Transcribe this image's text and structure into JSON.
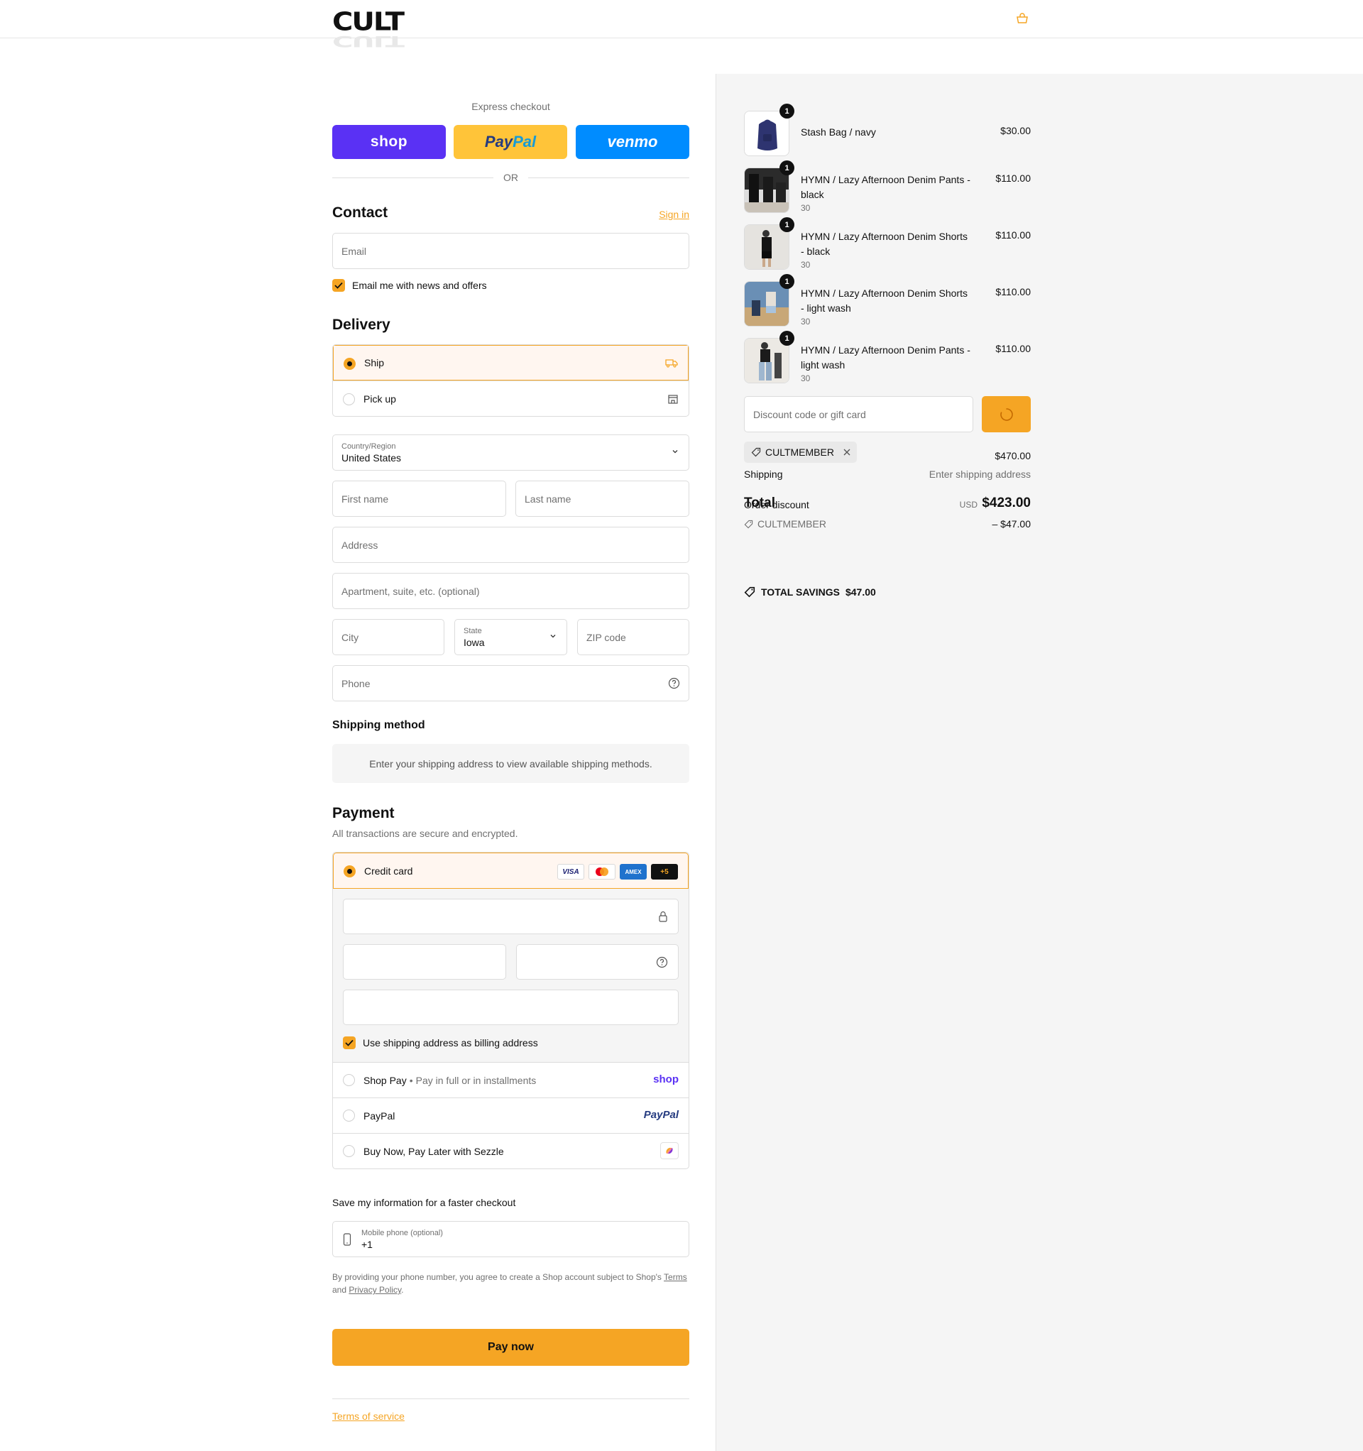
{
  "header": {
    "logo_text": "CULT",
    "cart_icon": "bag-icon"
  },
  "express": {
    "label": "Express checkout",
    "shop_label": "shop",
    "paypal_label_a": "Pay",
    "paypal_label_b": "Pal",
    "venmo_label": "venmo",
    "or_label": "OR"
  },
  "contact": {
    "title": "Contact",
    "signin_label": "Sign in",
    "email_placeholder": "Email",
    "news_label": "Email me with news and offers",
    "news_checked": true
  },
  "delivery": {
    "title": "Delivery",
    "options": [
      {
        "label": "Ship",
        "selected": true,
        "icon": "truck-icon"
      },
      {
        "label": "Pick up",
        "selected": false,
        "icon": "store-icon"
      }
    ],
    "country_label": "Country/Region",
    "country_value": "United States",
    "first_name_placeholder": "First name",
    "last_name_placeholder": "Last name",
    "address_placeholder": "Address",
    "apartment_placeholder": "Apartment, suite, etc. (optional)",
    "city_placeholder": "City",
    "state_label": "State",
    "state_value": "Iowa",
    "zip_placeholder": "ZIP code",
    "phone_placeholder": "Phone"
  },
  "shipping_method": {
    "title": "Shipping method",
    "note": "Enter your shipping address to view available shipping methods."
  },
  "payment": {
    "title": "Payment",
    "subtitle": "All transactions are secure and encrypted.",
    "credit_card_label": "Credit card",
    "card_brands": [
      "VISA",
      "MC",
      "AMEX",
      "+5"
    ],
    "billing_label": "Use shipping address as billing address",
    "billing_checked": true,
    "options": [
      {
        "label": "Shop Pay",
        "sub": "Pay in full or in installments",
        "brand": "shop"
      },
      {
        "label": "PayPal",
        "sub": "",
        "brand": "PayPal"
      },
      {
        "label": "Buy Now, Pay Later with Sezzle",
        "sub": "",
        "brand": "sezzle-icon"
      }
    ]
  },
  "save_info": {
    "title": "Save my information for a faster checkout",
    "mobile_label": "Mobile phone (optional)",
    "mobile_value": "+1",
    "legal_a": "By providing your phone number, you agree to create a Shop account subject to Shop's",
    "legal_terms": "Terms",
    "legal_and": "and",
    "legal_privacy": "Privacy Policy",
    "legal_end": "."
  },
  "pay_now_label": "Pay now",
  "terms_label": "Terms of service",
  "summary": {
    "items": [
      {
        "name": "Stash Bag / navy",
        "variant": "",
        "price": "$30.00",
        "qty": "1"
      },
      {
        "name": "HYMN / Lazy Afternoon Denim Pants - black",
        "variant": "30",
        "price": "$110.00",
        "qty": "1"
      },
      {
        "name": "HYMN / Lazy Afternoon Denim Shorts - black",
        "variant": "30",
        "price": "$110.00",
        "qty": "1"
      },
      {
        "name": "HYMN / Lazy Afternoon Denim Shorts - light wash",
        "variant": "30",
        "price": "$110.00",
        "qty": "1"
      },
      {
        "name": "HYMN / Lazy Afternoon Denim Pants - light wash",
        "variant": "30",
        "price": "$110.00",
        "qty": "1"
      }
    ],
    "discount_placeholder": "Discount code or gift card",
    "applied_code": "CULTMEMBER",
    "subtotal_value": "$470.00",
    "shipping_label": "Shipping",
    "shipping_value": "Enter shipping address",
    "total_label": "Total",
    "order_discount_label": "Order discount",
    "currency": "USD",
    "total_value": "$423.00",
    "discount_code": "CULTMEMBER",
    "discount_value": "– $47.00",
    "savings_label": "TOTAL SAVINGS",
    "savings_value": "$47.00"
  },
  "colors": {
    "accent": "#f5a524",
    "shop": "#5a31f4",
    "paypal": "#ffc439",
    "venmo": "#008cff"
  }
}
